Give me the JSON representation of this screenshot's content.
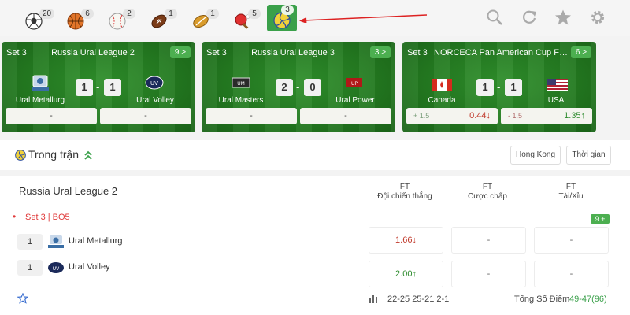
{
  "sports": [
    {
      "icon": "soccer-ball-icon",
      "count": "20"
    },
    {
      "icon": "basketball-icon",
      "count": "6"
    },
    {
      "icon": "baseball-icon",
      "count": "2"
    },
    {
      "icon": "american-football-icon",
      "count": "1"
    },
    {
      "icon": "rugby-ball-icon",
      "count": "1"
    },
    {
      "icon": "table-tennis-icon",
      "count": "5"
    },
    {
      "icon": "volleyball-icon",
      "count": "3"
    }
  ],
  "tools": [
    "search-icon",
    "refresh-icon",
    "star-icon",
    "gear-icon"
  ],
  "cards": [
    {
      "set": "Set 3",
      "league": "Russia Ural League 2",
      "more": "9 >",
      "home": "Ural Metallurg",
      "away": "Ural Volley",
      "home_score": "1",
      "away_score": "1",
      "odds": [
        {
          "val": "-"
        },
        {
          "val": "-"
        }
      ]
    },
    {
      "set": "Set 3",
      "league": "Russia Ural League 3",
      "more": "3 >",
      "home": "Ural Masters",
      "away": "Ural Power",
      "home_score": "2",
      "away_score": "0",
      "odds": [
        {
          "val": "-"
        },
        {
          "val": "-"
        }
      ]
    },
    {
      "set": "Set 3",
      "league": "NORCECA Pan American Cup Fi...",
      "more": "6 >",
      "home": "Canada",
      "away": "USA",
      "home_score": "1",
      "away_score": "1",
      "odds": [
        {
          "handicap": "+ 1.5",
          "val": "0.44↓"
        },
        {
          "handicap": "- 1.5",
          "val": "1.35↑"
        }
      ]
    }
  ],
  "inplay": {
    "title": "Trong trận",
    "btn_hongkong": "Hong Kong",
    "btn_time": "Thời gian"
  },
  "league_table": {
    "name": "Russia Ural League 2",
    "columns": [
      {
        "line1": "FT",
        "line2": "Đội chiến thắng"
      },
      {
        "line1": "FT",
        "line2": "Cược chấp"
      },
      {
        "line1": "FT",
        "line2": "Tài/Xỉu"
      }
    ],
    "set_info": "Set 3 | BO5",
    "more": "9 +",
    "rows": [
      {
        "score": "1",
        "team": "Ural Metallurg",
        "win_odd": "1.66↓",
        "handicap": "-",
        "overunder": "-"
      },
      {
        "score": "1",
        "team": "Ural Volley",
        "win_odd": "2.00↑",
        "handicap": "-",
        "overunder": "-"
      }
    ],
    "set_scores": "22-25 25-21 2-1",
    "total_points_label": "Tổng Số Điểm",
    "total_points": "49-47(96)"
  },
  "colors": {
    "green": "#3aa04a",
    "red": "#c0392b",
    "odd_green": "#2e8b2e"
  }
}
